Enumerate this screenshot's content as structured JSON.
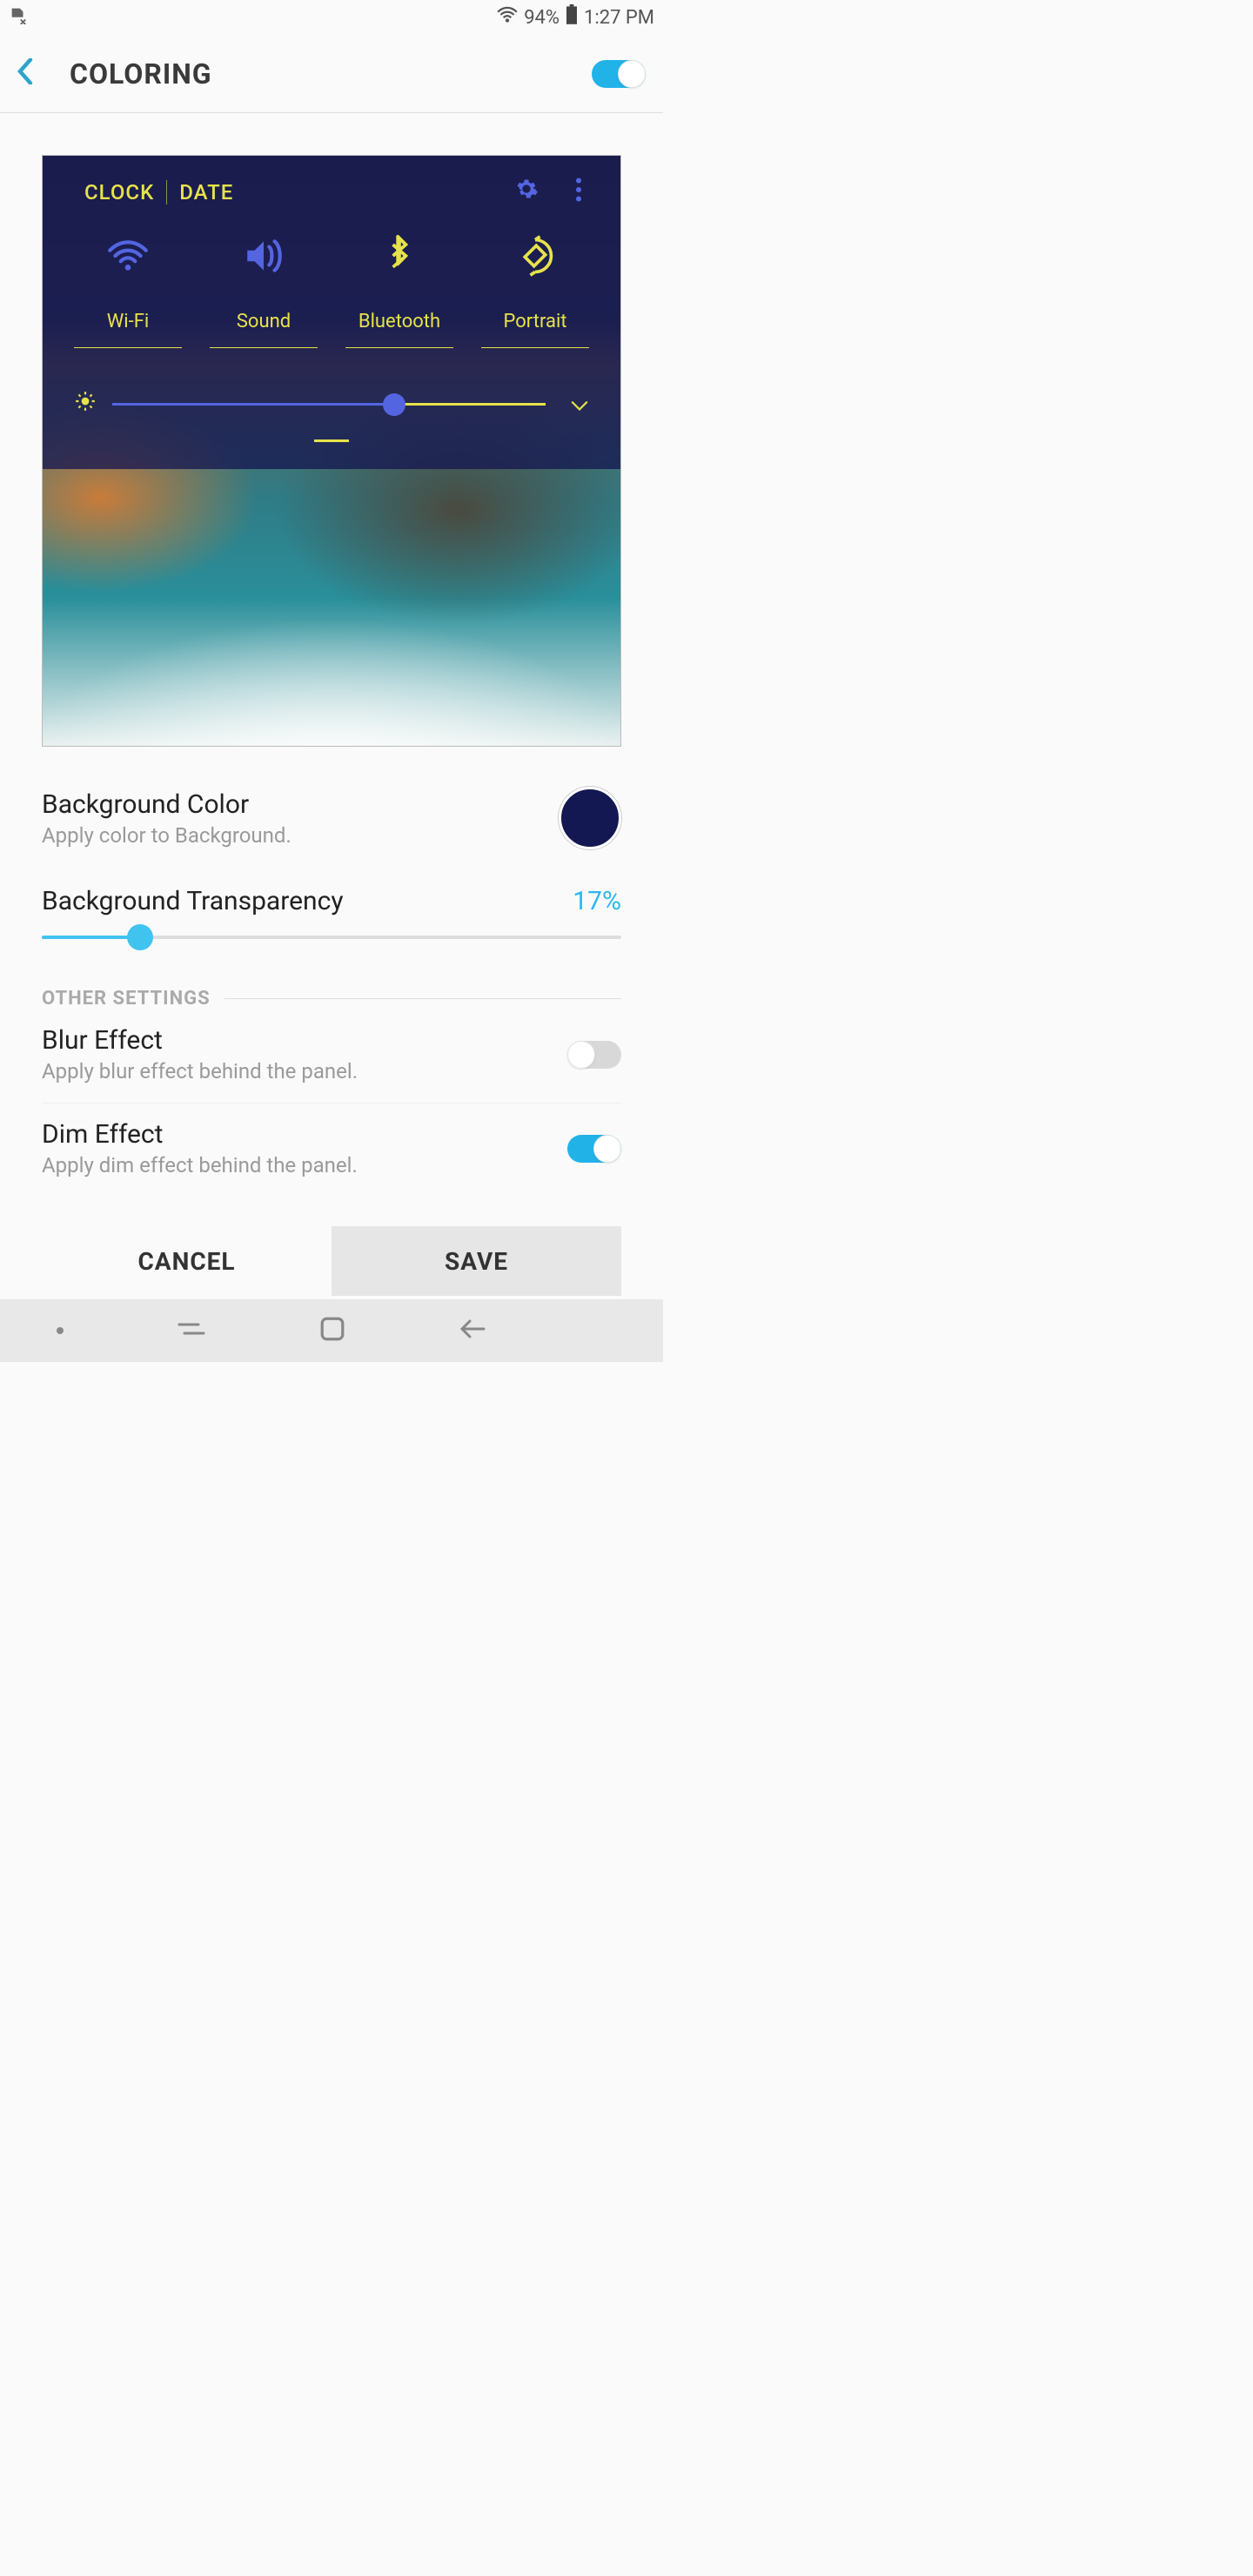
{
  "status": {
    "battery_pct": "94%",
    "time": "1:27 PM"
  },
  "header": {
    "title": "COLORING",
    "toggle_on": true
  },
  "preview": {
    "tabs": [
      "CLOCK",
      "DATE"
    ],
    "quick_settings": [
      {
        "label": "Wi-Fi",
        "icon": "wifi",
        "color": "#5465E2"
      },
      {
        "label": "Sound",
        "icon": "sound",
        "color": "#5465E2"
      },
      {
        "label": "Bluetooth",
        "icon": "bluetooth",
        "color": "#E7E24B"
      },
      {
        "label": "Portrait",
        "icon": "rotate",
        "color": "#E7E24B"
      }
    ],
    "brightness_pct": 65
  },
  "background_color": {
    "title": "Background Color",
    "desc": "Apply color to Background.",
    "color": "#141852"
  },
  "transparency": {
    "title": "Background Transparency",
    "value_label": "17%",
    "value": 17
  },
  "section_other": "OTHER SETTINGS",
  "blur": {
    "title": "Blur Effect",
    "desc": "Apply blur effect behind the panel.",
    "on": false
  },
  "dim": {
    "title": "Dim Effect",
    "desc": "Apply dim effect behind the panel.",
    "on": true
  },
  "buttons": {
    "cancel": "CANCEL",
    "save": "SAVE"
  }
}
